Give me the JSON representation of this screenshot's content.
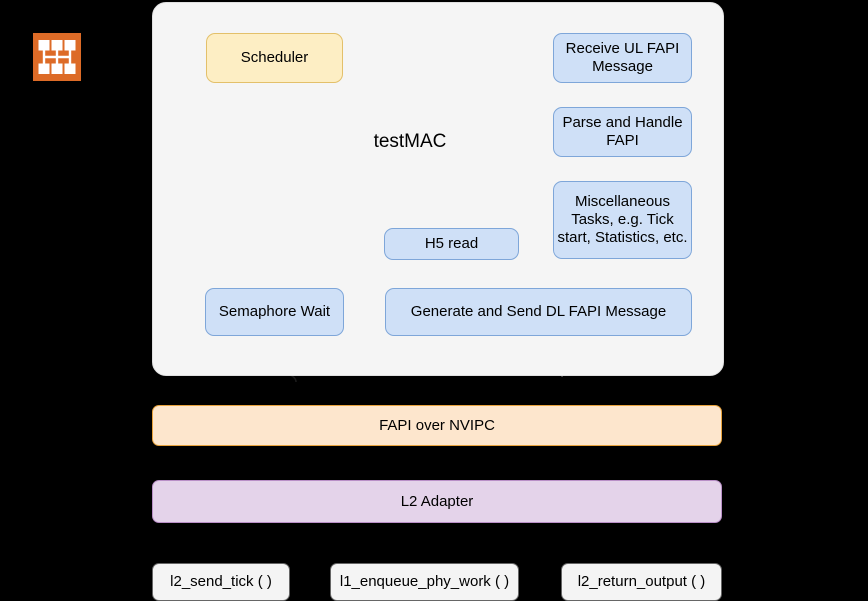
{
  "diagram": {
    "title": "testMAC",
    "icon": {
      "name": "network-topology-icon",
      "color": "#dd6b27"
    },
    "container_label": "testMAC",
    "nodes": [
      {
        "id": "scheduler",
        "label": "Scheduler",
        "color": "#fdeec4"
      },
      {
        "id": "recv_ul",
        "label": "Receive UL FAPI Message",
        "color": "#cfe0f7"
      },
      {
        "id": "parse_fapi",
        "label": "Parse and Handle FAPI",
        "color": "#cfe0f7"
      },
      {
        "id": "misc_tasks",
        "label": "Miscellaneous Tasks, e.g. Tick start, Statistics, etc.",
        "color": "#cfe0f7"
      },
      {
        "id": "h5_read",
        "label": "H5 read",
        "color": "#cfe0f7"
      },
      {
        "id": "semaphore",
        "label": "Semaphore Wait",
        "color": "#cfe0f7"
      },
      {
        "id": "generate_dl",
        "label": "Generate and Send DL FAPI Message",
        "color": "#cfe0f7"
      },
      {
        "id": "fapi_nvipc",
        "label": "FAPI over NVIPC",
        "color": "#fde6cd"
      },
      {
        "id": "l2_adapter",
        "label": "L2 Adapter",
        "color": "#e4d3ea"
      },
      {
        "id": "fn_send_tick",
        "label": "l2_send_tick ( )",
        "color": "#f4f4f4"
      },
      {
        "id": "fn_enqueue",
        "label": "l1_enqueue_phy_work ( )",
        "color": "#f4f4f4"
      },
      {
        "id": "fn_return_out",
        "label": "l2_return_output ( )",
        "color": "#f4f4f4"
      }
    ],
    "edges": [
      {
        "from": "external",
        "to": "scheduler",
        "style": "solid"
      },
      {
        "from": "scheduler",
        "to": "recv_ul",
        "style": "dashed"
      },
      {
        "from": "recv_ul",
        "to": "parse_fapi",
        "style": "dashed"
      },
      {
        "from": "parse_fapi",
        "to": "misc_tasks",
        "style": "dashed"
      },
      {
        "from": "misc_tasks",
        "to": "generate_dl",
        "style": "dashed"
      },
      {
        "from": "h5_read",
        "to": "generate_dl",
        "style": "solid"
      },
      {
        "from": "generate_dl",
        "to": "semaphore",
        "style": "dashed"
      },
      {
        "from": "semaphore",
        "to": "scheduler",
        "style": "dashed"
      },
      {
        "from": "below",
        "to": "semaphore",
        "style": "solid"
      },
      {
        "from": "generate_dl",
        "to": "below",
        "style": "solid"
      }
    ]
  }
}
